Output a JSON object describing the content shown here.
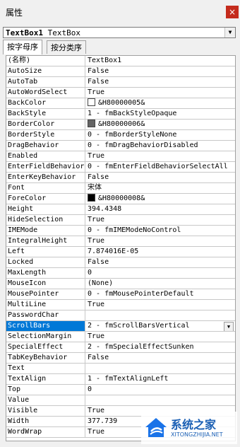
{
  "window": {
    "title": "属性",
    "close": "×"
  },
  "object_selector": {
    "name": "TextBox1",
    "type": "TextBox"
  },
  "tabs": [
    "按字母序",
    "按分类序"
  ],
  "properties": [
    {
      "name": "(名称)",
      "value": "TextBox1"
    },
    {
      "name": "AutoSize",
      "value": "False"
    },
    {
      "name": "AutoTab",
      "value": "False"
    },
    {
      "name": "AutoWordSelect",
      "value": "True"
    },
    {
      "name": "BackColor",
      "value": "&H80000005&",
      "swatch": "#ffffff"
    },
    {
      "name": "BackStyle",
      "value": "1 - fmBackStyleOpaque"
    },
    {
      "name": "BorderColor",
      "value": "&H80000006&",
      "swatch": "#646464"
    },
    {
      "name": "BorderStyle",
      "value": "0 - fmBorderStyleNone"
    },
    {
      "name": "DragBehavior",
      "value": "0 - fmDragBehaviorDisabled"
    },
    {
      "name": "Enabled",
      "value": "True"
    },
    {
      "name": "EnterFieldBehavior",
      "value": "0 - fmEnterFieldBehaviorSelectAll"
    },
    {
      "name": "EnterKeyBehavior",
      "value": "False"
    },
    {
      "name": "Font",
      "value": "宋体"
    },
    {
      "name": "ForeColor",
      "value": "&H80000008&",
      "swatch": "#000000"
    },
    {
      "name": "Height",
      "value": "394.4348"
    },
    {
      "name": "HideSelection",
      "value": "True"
    },
    {
      "name": "IMEMode",
      "value": "0 - fmIMEModeNoControl"
    },
    {
      "name": "IntegralHeight",
      "value": "True"
    },
    {
      "name": "Left",
      "value": "7.874016E-05"
    },
    {
      "name": "Locked",
      "value": "False"
    },
    {
      "name": "MaxLength",
      "value": "0"
    },
    {
      "name": "MouseIcon",
      "value": "(None)"
    },
    {
      "name": "MousePointer",
      "value": "0 - fmMousePointerDefault"
    },
    {
      "name": "MultiLine",
      "value": "True"
    },
    {
      "name": "PasswordChar",
      "value": ""
    },
    {
      "name": "ScrollBars",
      "value": "2 - fmScrollBarsVertical",
      "selected": true
    },
    {
      "name": "SelectionMargin",
      "value": "True"
    },
    {
      "name": "SpecialEffect",
      "value": "2 - fmSpecialEffectSunken"
    },
    {
      "name": "TabKeyBehavior",
      "value": "False"
    },
    {
      "name": "Text",
      "value": ""
    },
    {
      "name": "TextAlign",
      "value": "1 - fmTextAlignLeft"
    },
    {
      "name": "Top",
      "value": "0"
    },
    {
      "name": "Value",
      "value": ""
    },
    {
      "name": "Visible",
      "value": "True"
    },
    {
      "name": "Width",
      "value": "377.739"
    },
    {
      "name": "WordWrap",
      "value": "True"
    }
  ],
  "watermark": {
    "title": "系统之家",
    "subtitle": "XITONGZHIJIA.NET"
  }
}
